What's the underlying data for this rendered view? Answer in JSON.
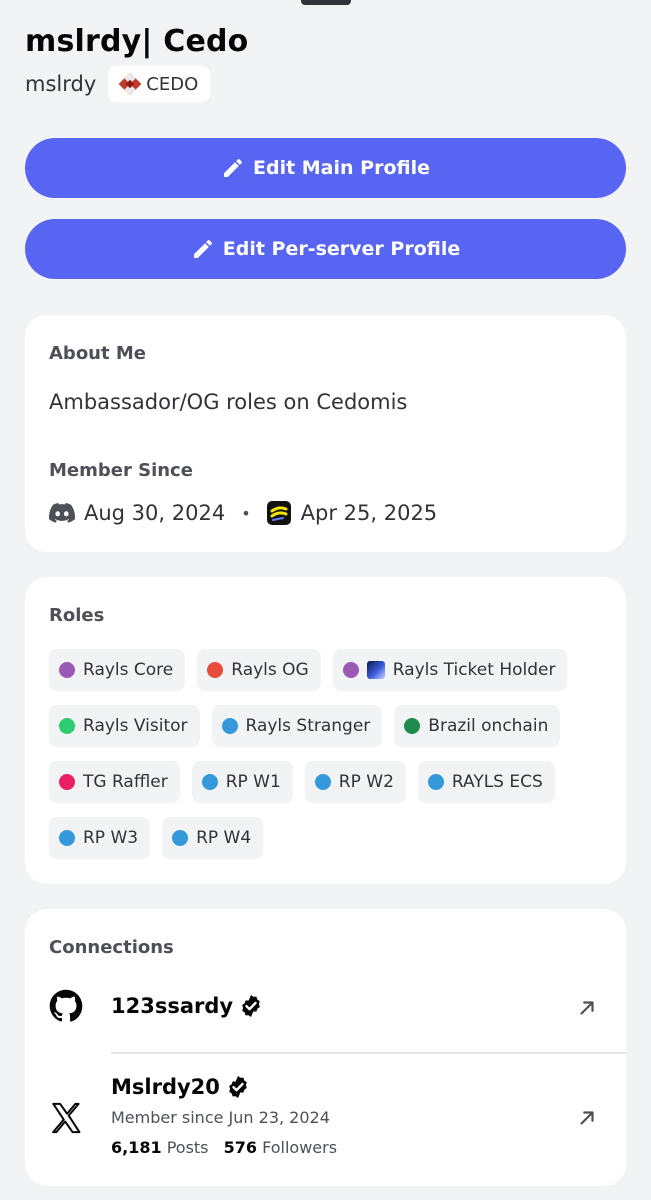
{
  "profile": {
    "display_name": "mslrdy| Cedo",
    "username": "mslrdy",
    "server_tag": "CEDO"
  },
  "actions": {
    "edit_main": "Edit Main Profile",
    "edit_server": "Edit Per-server Profile"
  },
  "about": {
    "title": "About Me",
    "text": "Ambassador/OG roles on Cedomis",
    "member_since_title": "Member Since",
    "discord_date": "Aug 30, 2024",
    "separator": "•",
    "server_date": "Apr 25, 2025"
  },
  "roles": {
    "title": "Roles",
    "items": [
      {
        "label": "Rayls Core",
        "color": "#9b59b6"
      },
      {
        "label": "Rayls OG",
        "color": "#e74c3c"
      },
      {
        "label": "Rayls Ticket Holder",
        "color": "#9b59b6",
        "icon": "rayls-ticket-image"
      },
      {
        "label": "Rayls Visitor",
        "color": "#2ecc71"
      },
      {
        "label": "Rayls Stranger",
        "color": "#3498db"
      },
      {
        "label": "Brazil onchain",
        "color": "#1f8b4c"
      },
      {
        "label": "TG Raffler",
        "color": "#e91e63"
      },
      {
        "label": "RP W1",
        "color": "#3498db"
      },
      {
        "label": "RP W2",
        "color": "#3498db"
      },
      {
        "label": "RAYLS ECS",
        "color": "#3498db"
      },
      {
        "label": "RP W3",
        "color": "#3498db"
      },
      {
        "label": "RP W4",
        "color": "#3498db"
      }
    ]
  },
  "connections": {
    "title": "Connections",
    "github": {
      "name": "123ssardy",
      "icon": "github-icon"
    },
    "x": {
      "name": "Mslrdy20",
      "member_since": "Member since Jun 23, 2024",
      "posts_count": "6,181",
      "posts_label": "Posts",
      "followers_count": "576",
      "followers_label": "Followers",
      "icon": "x-icon"
    }
  },
  "colors": {
    "accent": "#5865f2",
    "background": "#f2f3f5",
    "card": "#ffffff"
  }
}
